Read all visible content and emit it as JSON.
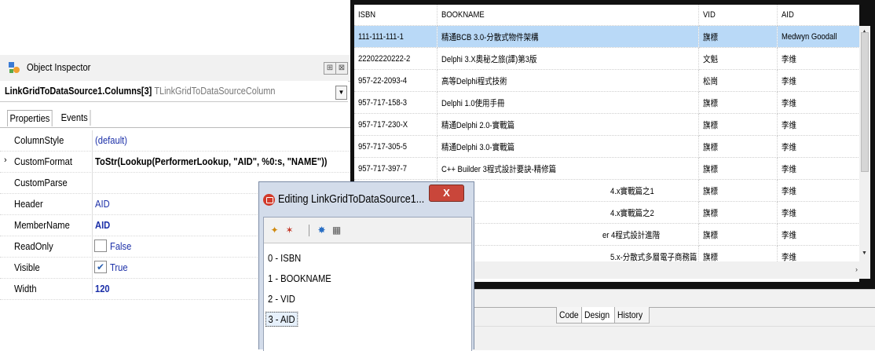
{
  "inspector": {
    "title": "Object Inspector",
    "pin_icon": "pin-icon",
    "close_icon": "close-icon",
    "object_name": "LinkGridToDataSource1.Columns[3]",
    "object_class": "TLinkGridToDataSourceColumn",
    "tabs": [
      "Properties",
      "Events"
    ],
    "properties": [
      {
        "name": "ColumnStyle",
        "value": "(default)"
      },
      {
        "name": "CustomFormat",
        "value": "ToStr(Lookup(PerformerLookup, \"AID\", %0:s, \"NAME\"))"
      },
      {
        "name": "CustomParse",
        "value": ""
      },
      {
        "name": "Header",
        "value": "AID"
      },
      {
        "name": "MemberName",
        "value": "AID"
      },
      {
        "name": "ReadOnly",
        "value": "False",
        "checked": false
      },
      {
        "name": "Visible",
        "value": "True",
        "checked": true
      },
      {
        "name": "Width",
        "value": "120"
      }
    ]
  },
  "grid": {
    "columns": [
      "ISBN",
      "BOOKNAME",
      "VID",
      "AID"
    ],
    "rows": [
      [
        "111-111-111-1",
        "精通BCB 3.0-分散式物件架構",
        "旗標",
        "Medwyn Goodall"
      ],
      [
        "22202220222-2",
        "Delphi 3.X奧秘之旅(譯)第3版",
        "文魁",
        "李维"
      ],
      [
        "957-22-2093-4",
        "高等Delphi程式技術",
        "松崗",
        "李维"
      ],
      [
        "957-717-158-3",
        "Delphi  1.0使用手冊",
        "旗標",
        "李维"
      ],
      [
        "957-717-230-X",
        "精通Delphi 2.0-實戰篇",
        "旗標",
        "李维"
      ],
      [
        "957-717-305-5",
        "精通Delphi 3.0-實戰篇",
        "旗標",
        "李维"
      ],
      [
        "957-717-397-7",
        "C++ Builder 3程式設計要訣-精修篇",
        "旗標",
        "李维"
      ],
      [
        "",
        "4.x實戰篇之1",
        "旗標",
        "李维"
      ],
      [
        "",
        "4.x實戰篇之2",
        "旗標",
        "李维"
      ],
      [
        "",
        "er 4程式設計進階",
        "旗標",
        "李维"
      ],
      [
        "",
        "5.x-分散式多層電子商務篇",
        "旗標",
        "李维"
      ]
    ],
    "selected_row": 0
  },
  "designer_tabs": [
    "Code",
    "Design",
    "History"
  ],
  "dialog": {
    "title": "Editing LinkGridToDataSource1...",
    "close_label": "X",
    "toolbar_icons": [
      "add-item-icon",
      "delete-item-icon",
      "move-item-icon",
      "grid-icon"
    ],
    "items": [
      "0 - ISBN",
      "1 - BOOKNAME",
      "2 - VID",
      "3 - AID"
    ],
    "selected_item": 3
  }
}
